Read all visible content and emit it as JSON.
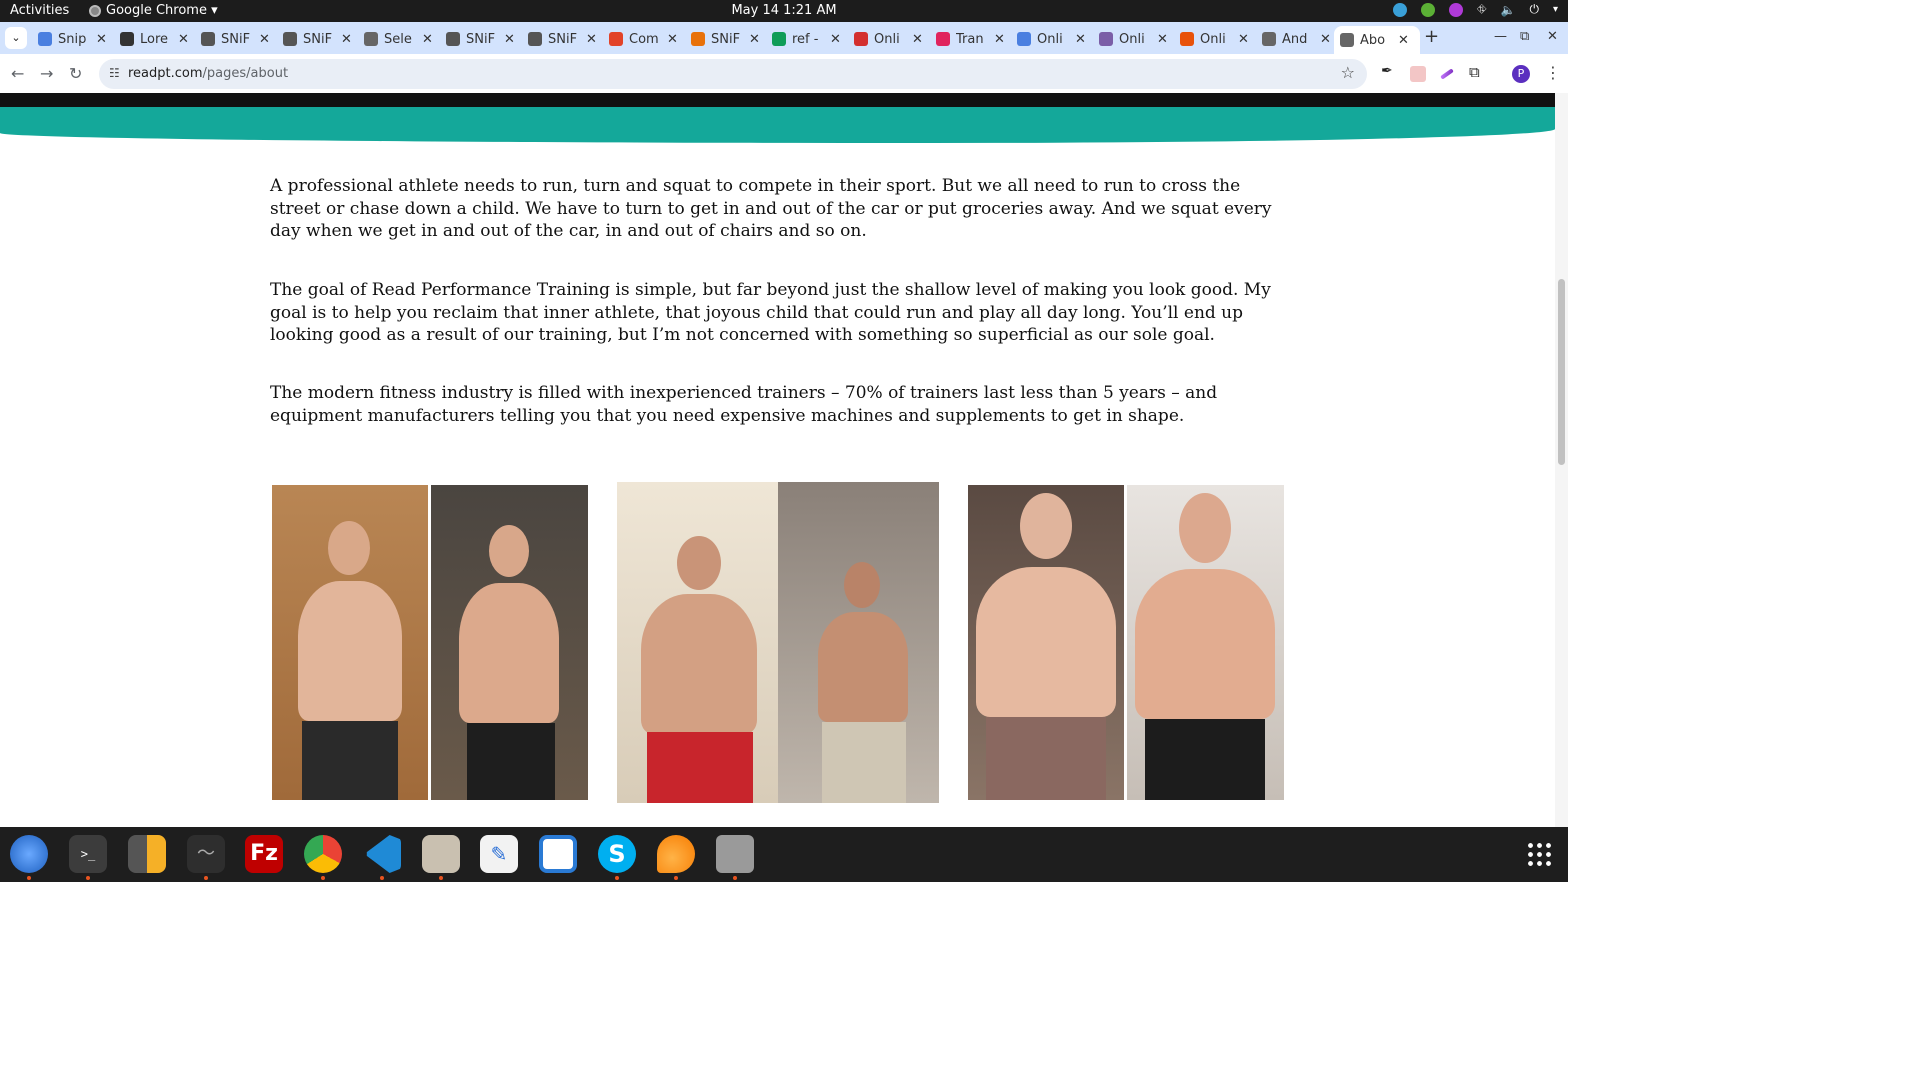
{
  "topbar": {
    "activities": "Activities",
    "app_name": "Google Chrome ▾",
    "clock": "May 14  1:21 AM"
  },
  "tabs": [
    {
      "title": "Snip",
      "favicon_color": "#4a7fe0"
    },
    {
      "title": "Lore",
      "favicon_color": "#333333"
    },
    {
      "title": "SNiF",
      "favicon_color": "#555555"
    },
    {
      "title": "SNiF",
      "favicon_color": "#555555"
    },
    {
      "title": "Sele",
      "favicon_color": "#666666"
    },
    {
      "title": "SNiF",
      "favicon_color": "#555555"
    },
    {
      "title": "SNiF",
      "favicon_color": "#555555"
    },
    {
      "title": "Com",
      "favicon_color": "#e24329"
    },
    {
      "title": "SNiF",
      "favicon_color": "#e8710a"
    },
    {
      "title": "ref -",
      "favicon_color": "#0f9d58"
    },
    {
      "title": "Onli",
      "favicon_color": "#d32f2f"
    },
    {
      "title": "Tran",
      "favicon_color": "#e0245e"
    },
    {
      "title": "Onli",
      "favicon_color": "#4a7fe0"
    },
    {
      "title": "Onli",
      "favicon_color": "#7b5ea7"
    },
    {
      "title": "Onli",
      "favicon_color": "#e8520a"
    },
    {
      "title": "And",
      "favicon_color": "#666666"
    },
    {
      "title": "Abo",
      "favicon_color": "#666666",
      "active": true
    }
  ],
  "toolbar": {
    "url_host": "readpt.com",
    "url_path": "/pages/about",
    "profile_initial": "P"
  },
  "content": {
    "paragraphs": [
      "A professional athlete needs to run, turn and squat to compete in their sport. But we all need to run to cross the street or chase down a child. We have to turn to get in and out of the car or put groceries away. And we squat every day when we get in and out of the car, in and out of chairs and so on.",
      "The goal of Read Performance Training is simple, but far beyond just the shallow level of making you look good. My goal is to help you reclaim that inner athlete, that joyous child that could run and play all day long. You’ll end up looking good as a result of our training, but I’m not concerned with something so superficial as our sole goal.",
      "The modern fitness industry is filled with inexperienced trainers – 70% of trainers last less than 5 years – and equipment manufacturers telling you that you need expensive machines and supplements to get in shape."
    ]
  },
  "colors": {
    "teal_banner": "#14a89a",
    "tabstrip_bg": "#d3e3fd",
    "dock_bg": "#1e1e1e",
    "ubuntu_orange": "#e95420"
  },
  "dock_apps": [
    "thunderbird-icon",
    "terminal-icon",
    "calculator-icon",
    "system-monitor-icon",
    "filezilla-icon",
    "chrome-icon",
    "vscode-icon",
    "files-icon",
    "text-editor-icon",
    "libreoffice-writer-icon",
    "skype-icon",
    "xampp-icon",
    "disk-icon"
  ]
}
